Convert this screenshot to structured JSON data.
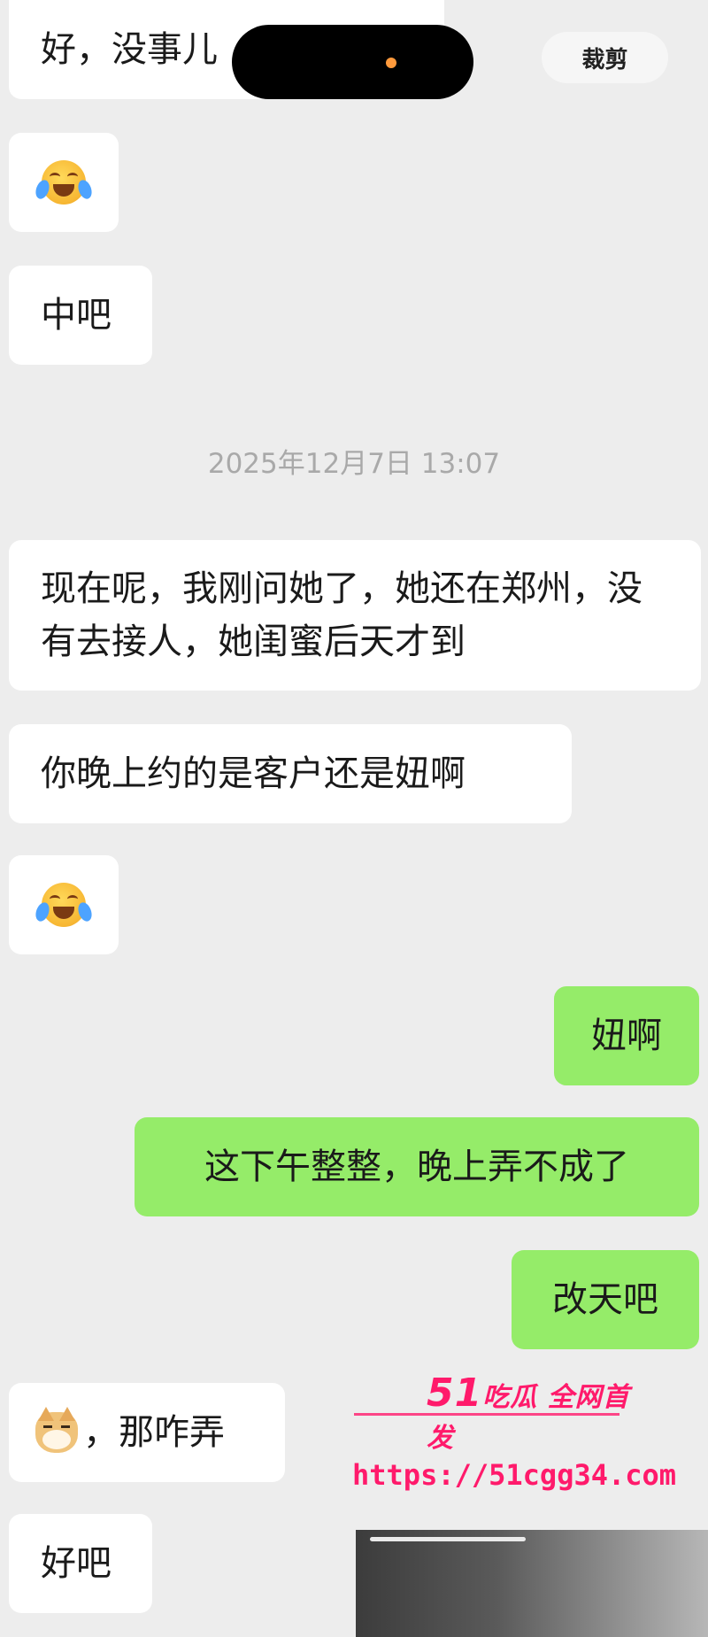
{
  "toolbar": {
    "crop_label": "裁剪"
  },
  "timestamp": "2025年12月7日 13:07",
  "messages": [
    {
      "side": "left",
      "type": "text",
      "text": "好，没事儿"
    },
    {
      "side": "left",
      "type": "emoji",
      "icon": "laughing-tears-emoji"
    },
    {
      "side": "left",
      "type": "text",
      "text": "中吧"
    },
    {
      "side": "left",
      "type": "text",
      "text": "现在呢，我刚问她了，她还在郑州，没有去接人，她闺蜜后天才到"
    },
    {
      "side": "left",
      "type": "text",
      "text": "你晚上约的是客户还是妞啊"
    },
    {
      "side": "left",
      "type": "emoji",
      "icon": "laughing-tears-emoji"
    },
    {
      "side": "right",
      "type": "text",
      "text": "妞啊"
    },
    {
      "side": "right",
      "type": "text",
      "text": "这下午整整，晚上弄不成了"
    },
    {
      "side": "right",
      "type": "text",
      "text": "改天吧"
    },
    {
      "side": "left",
      "type": "emoji_text",
      "icon": "doge-emoji",
      "text": "，那咋弄"
    },
    {
      "side": "left",
      "type": "text",
      "text": "好吧"
    }
  ],
  "watermark": {
    "brand_num": "51",
    "brand_text": "吃瓜 全网首发",
    "url": "https://51cgg34.com"
  },
  "colors": {
    "background": "#ededed",
    "incoming_bubble": "#ffffff",
    "outgoing_bubble": "#95ec69",
    "watermark": "#ff1a6b"
  }
}
